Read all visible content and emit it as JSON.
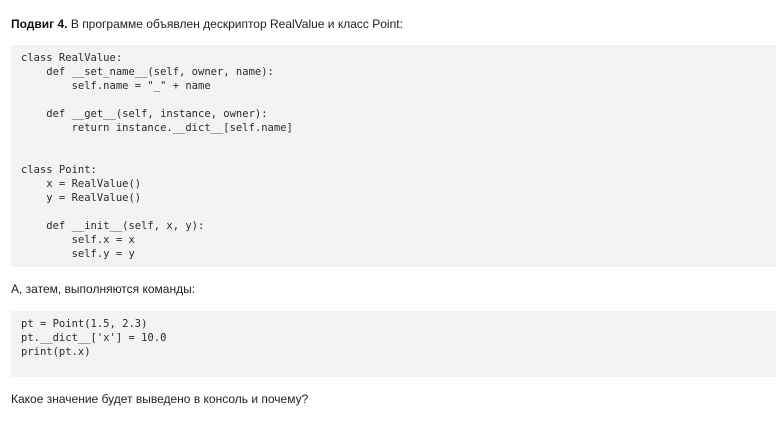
{
  "task": {
    "label": "Подвиг 4.",
    "intro": " В программе объявлен дескриптор RealValue и класс Point:"
  },
  "code_block_1": [
    "class RealValue:",
    "    def __set_name__(self, owner, name):",
    "        self.name = \"_\" + name",
    "",
    "    def __get__(self, instance, owner):",
    "        return instance.__dict__[self.name]",
    "",
    "",
    "class Point:",
    "    x = RealValue()",
    "    y = RealValue()",
    "",
    "    def __init__(self, x, y):",
    "        self.x = x",
    "        self.y = y"
  ],
  "middle_text": "А, затем, выполняются команды:",
  "code_block_2": [
    "pt = Point(1.5, 2.3)",
    "pt.__dict__['x'] = 10.0",
    "print(pt.x)"
  ],
  "question": "Какое значение будет выведено в консоль и почему?"
}
